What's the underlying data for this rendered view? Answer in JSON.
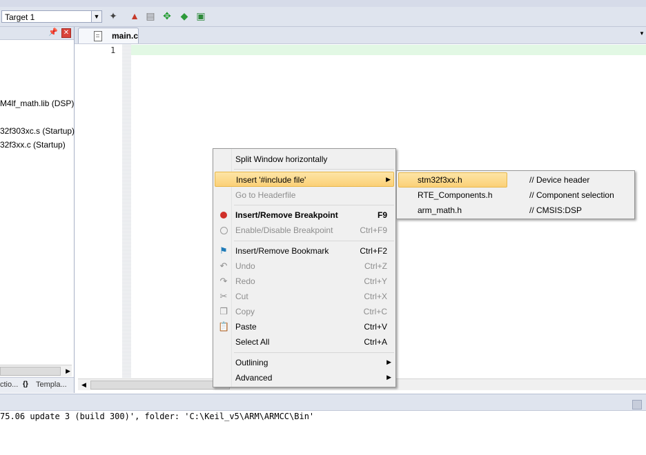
{
  "toolbar": {
    "target_name": "Target 1",
    "icons": [
      "magic-wand-icon",
      "load-icon",
      "options-icon",
      "manage-icon",
      "diamond-icon",
      "pack-icon",
      "pack-installer-icon"
    ]
  },
  "project_panel": {
    "tree_items": [
      "M4lf_math.lib (DSP)",
      "32f303xc.s (Startup)",
      "32f3xx.c (Startup)"
    ],
    "tabs": [
      "ctio...",
      "Templa..."
    ]
  },
  "editor": {
    "active_tab": "main.c",
    "line_numbers": [
      "1"
    ]
  },
  "context_menu": {
    "items": [
      {
        "label": "Split Window horizontally",
        "key": "",
        "disabled": false
      },
      {
        "label": "Insert '#include file'",
        "key": "",
        "submenu": true,
        "highlighted": true
      },
      {
        "label": "Go to Headerfile",
        "key": "",
        "disabled": true
      },
      {
        "label": "Insert/Remove Breakpoint",
        "key": "F9",
        "bold": true
      },
      {
        "label": "Enable/Disable Breakpoint",
        "key": "Ctrl+F9",
        "disabled": true
      },
      {
        "label": "Insert/Remove Bookmark",
        "key": "Ctrl+F2"
      },
      {
        "label": "Undo",
        "key": "Ctrl+Z",
        "disabled": true
      },
      {
        "label": "Redo",
        "key": "Ctrl+Y",
        "disabled": true
      },
      {
        "label": "Cut",
        "key": "Ctrl+X",
        "disabled": true
      },
      {
        "label": "Copy",
        "key": "Ctrl+C",
        "disabled": true
      },
      {
        "label": "Paste",
        "key": "Ctrl+V"
      },
      {
        "label": "Select All",
        "key": "Ctrl+A"
      },
      {
        "label": "Outlining",
        "key": "",
        "submenu": true
      },
      {
        "label": "Advanced",
        "key": "",
        "submenu": true
      }
    ]
  },
  "include_submenu": {
    "items": [
      {
        "file": "stm32f3xx.h",
        "comment": "// Device header",
        "highlighted": true
      },
      {
        "file": "RTE_Components.h",
        "comment": "// Component selection"
      },
      {
        "file": "arm_math.h",
        "comment": "// CMSIS:DSP"
      }
    ]
  },
  "build_output": {
    "text": "75.06 update 3 (build 300)', folder: 'C:\\Keil_v5\\ARM\\ARMCC\\Bin'"
  },
  "colors": {
    "menu_highlight": "#fbd077",
    "current_line": "#e2f8e4",
    "breakpoint": "#d0302a"
  }
}
